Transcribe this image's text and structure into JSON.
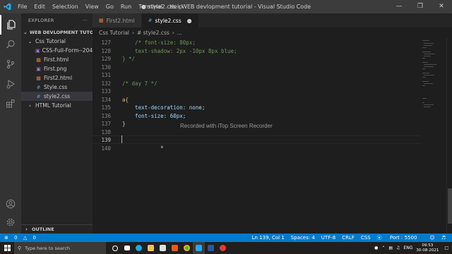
{
  "titlebar": {
    "menu": [
      "File",
      "Edit",
      "Selection",
      "View",
      "Go",
      "Run",
      "Terminal",
      "Help"
    ],
    "title": "● style2.css - WEB devlopment tutorial - Visual Studio Code"
  },
  "sidebar": {
    "header": "EXPLORER",
    "more": "···",
    "workspace": "WEB DEVLOPMENT TUTOR...",
    "folder": "Css Tutorial",
    "files": [
      {
        "name": "CSS-Full-Form--204...",
        "icon": "image-icon"
      },
      {
        "name": "First.html",
        "icon": "html-icon"
      },
      {
        "name": "First.png",
        "icon": "image-icon"
      },
      {
        "name": "First2.html",
        "icon": "html-icon"
      },
      {
        "name": "Style.css",
        "icon": "css-icon"
      },
      {
        "name": "style2.css",
        "icon": "css-icon"
      }
    ],
    "html_folder": "HTML Tutorial",
    "outline": "OUTLINE"
  },
  "tabs": [
    {
      "label": "First2.html",
      "icon": "html-icon",
      "active": false
    },
    {
      "label": "style2.css",
      "icon": "css-icon",
      "active": true
    }
  ],
  "breadcrumb": [
    "Css Tutorial",
    "# style2.css",
    "..."
  ],
  "editor": {
    "lines": [
      {
        "n": "127",
        "text": "    /* font-size: 80px;"
      },
      {
        "n": "128",
        "text": "    text-shadow: 2px -10px 8px blue;"
      },
      {
        "n": "129",
        "text": "} */"
      },
      {
        "n": "130",
        "text": ""
      },
      {
        "n": "131",
        "text": ""
      },
      {
        "n": "132",
        "text": "/* day 7 */"
      },
      {
        "n": "133",
        "text": ""
      },
      {
        "n": "134",
        "text": "a{"
      },
      {
        "n": "135",
        "text": "    text-decoration: none;"
      },
      {
        "n": "136",
        "text": "    font-size: 60px;"
      },
      {
        "n": "137",
        "text": "}"
      },
      {
        "n": "138",
        "text": ""
      },
      {
        "n": "139",
        "text": ""
      },
      {
        "n": "140",
        "text": ""
      }
    ],
    "watermark": "Recorded with iTop Screen Recorder"
  },
  "statusbar": {
    "errors": "0",
    "warnings": "0",
    "position": "Ln 139, Col 1",
    "spaces": "Spaces: 4",
    "encoding": "UTF-8",
    "eol": "CRLF",
    "language": "CSS",
    "port": "Port : 5500"
  },
  "taskbar": {
    "search_placeholder": "Type here to search",
    "language": "ENG",
    "time": "09:53",
    "date": "30-08-2021"
  },
  "colors": {
    "accent": "#007acc",
    "css_icon": "#519aba",
    "html_icon": "#e37933",
    "image_icon": "#a074c4"
  }
}
